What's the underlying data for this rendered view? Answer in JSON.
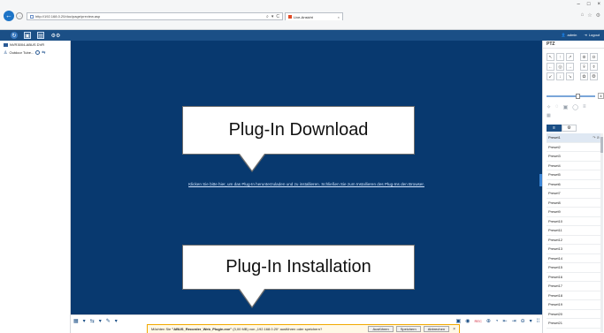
{
  "browser": {
    "back_glyph": "←",
    "forward_glyph": "→",
    "address": "http://192.168.0.20/doc/page/preview.asp",
    "addr_tools": [
      "⌕",
      "▾",
      "C"
    ],
    "tab_title": "Live-Ansicht",
    "tab_close": "×",
    "window_controls": [
      "–",
      "□",
      "×"
    ],
    "right_icons": [
      "⌂",
      "☆",
      "⚙"
    ]
  },
  "app": {
    "tools": [
      "↻",
      "▣",
      "▤",
      "⚙⚙"
    ],
    "user": "admin",
    "user_icon": "👤",
    "logout": "Logout",
    "logout_icon": "⇥"
  },
  "device_tree": {
    "device_name": "NVR3004-ABUS DVR",
    "camera_name": "Outdoor Tube..."
  },
  "video": {
    "plugin_link": "Klicken Sie bitte hier, um das Plug-In herunterzuladen und zu installieren. Schließen Sie zum Installieren des Plug-Ins den Browser.",
    "callout_download": "Plug-In Download",
    "callout_install": "Plug-In Installation"
  },
  "bottom_toolbar": {
    "left_icons": [
      "▦",
      "▾",
      "⇆",
      "▾",
      "✎",
      "▾"
    ],
    "right_icons": [
      "▣",
      "◉",
      "REC",
      "⊕",
      "◔",
      "⇤",
      "⇥",
      "⊖",
      "▾",
      "⁞⁞"
    ]
  },
  "notification": {
    "prefix": "Möchten Sie ",
    "file": "\"ABUS_Recorder_Web_Plugin.exe\"",
    "suffix": " (3,00 MB) von „192.168.0.20“ ausführen oder speichern?",
    "run_label": "Ausführen",
    "save_label": "Speichern",
    "cancel_label": "Abbrechen",
    "close": "×"
  },
  "ptz": {
    "title": "PTZ",
    "dir_buttons": [
      "↖",
      "↑",
      "↗",
      "←",
      "◎",
      "→",
      "↙",
      "↓",
      "↘"
    ],
    "zoom_buttons": [
      "⊕",
      "⊖",
      "⌾",
      "⌽",
      "✿",
      "❂"
    ],
    "slider_fraction": 0.6,
    "slider_value": "4",
    "icons": [
      "✧",
      "◌",
      "▣",
      "◯",
      "≡"
    ],
    "icons2": "▦",
    "tabs": [
      "≡",
      "⚙"
    ],
    "preset_tools": "↷ ⊘",
    "presets": [
      "Preset1",
      "Preset2",
      "Preset3",
      "Preset4",
      "Preset5",
      "Preset6",
      "Preset7",
      "Preset8",
      "Preset9",
      "Preset10",
      "Preset11",
      "Preset12",
      "Preset13",
      "Preset14",
      "Preset15",
      "Preset16",
      "Preset17",
      "Preset18",
      "Preset19",
      "Preset20",
      "Preset21"
    ]
  },
  "colors": {
    "header": "#1b4f86",
    "video_bg": "#08396f",
    "rec_red": "#d2263b",
    "notify_border": "#f2a900"
  }
}
